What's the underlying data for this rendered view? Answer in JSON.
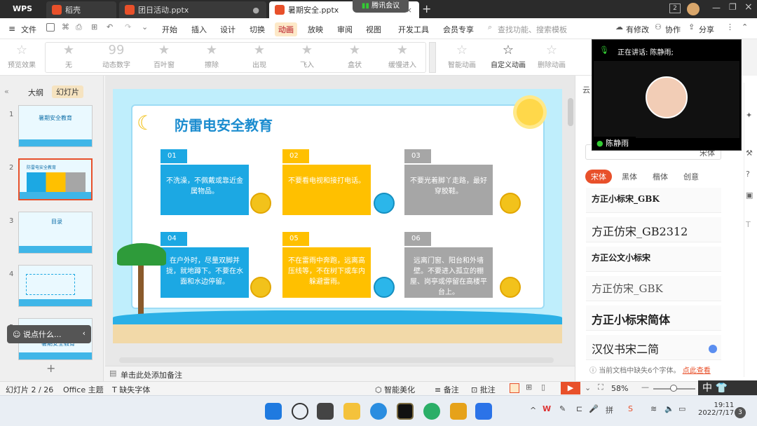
{
  "titlebar": {
    "wps": "WPS",
    "tabs": [
      {
        "label": "稻壳"
      },
      {
        "label": "团日活动.pptx"
      },
      {
        "label": "暑期安全.pptx"
      }
    ],
    "meeting_badge": "腾讯会议",
    "page_indicator": "2"
  },
  "ribbon": {
    "file": "文件",
    "tabs": [
      "开始",
      "插入",
      "设计",
      "切换",
      "动画",
      "放映",
      "审阅",
      "视图",
      "开发工具",
      "会员专享"
    ],
    "active_tab": "动画",
    "search_placeholder": "查找功能、搜索模板",
    "has_changes": "有修改",
    "collab": "协作",
    "share": "分享"
  },
  "toolbar": {
    "preview": "预览效果",
    "effects": [
      "无",
      "动态数字",
      "百叶窗",
      "擦除",
      "出现",
      "飞入",
      "盒状",
      "缓慢进入"
    ],
    "smart_anim": "智能动画",
    "custom_anim": "自定义动画",
    "delete_anim": "删除动画"
  },
  "leftpane": {
    "tab_outline": "大纲",
    "tab_slides": "幻灯片",
    "slides": [
      {
        "num": "1",
        "title": "暑期安全教育"
      },
      {
        "num": "2",
        "title": "防雷电安全教育"
      },
      {
        "num": "3",
        "title": "目录"
      },
      {
        "num": "4",
        "title": ""
      },
      {
        "num": "5",
        "title": "暑期安全教育"
      }
    ],
    "say_something": "说点什么..."
  },
  "slide": {
    "title": "防雷电安全教育",
    "cards": [
      {
        "num": "01",
        "text": "不洗澡，不佩戴或靠近金属物品。"
      },
      {
        "num": "02",
        "text": "不要看电视和接打电话。"
      },
      {
        "num": "03",
        "text": "不要光着脚丫走路，最好穿胶鞋。"
      },
      {
        "num": "04",
        "text": "在户外时，尽量双脚并拢，就地蹲下。不要在水面和水边停留。"
      },
      {
        "num": "05",
        "text": "不在雷雨中奔跑，远离高压线等，不在树下或车内躲避雷雨。"
      },
      {
        "num": "06",
        "text": "远离门窗、阳台和外墙壁。不要进入孤立的棚屋、岗亭或停留在高楼平台上。"
      }
    ],
    "colors": {
      "blue": "#1ca8e3",
      "yellow": "#ffc000",
      "gray": "#a6a6a6"
    }
  },
  "notes": "单击此处添加备注",
  "rightpane": {
    "header": "云",
    "search_btn": "宋体",
    "filters": [
      "宋体",
      "黑体",
      "楷体",
      "创意"
    ],
    "fonts": [
      "方正小标宋_GBK",
      "方正仿宋_GB2312",
      "方正公文小标宋",
      "方正仿宋_GBK",
      "方正小标宋简体",
      "汉仪书宋二简"
    ],
    "missing_notice": "当前文档中缺失6个字体。",
    "view_link": "点此查看"
  },
  "meeting": {
    "speaking": "正在讲话: 陈静雨;",
    "name": "陈静雨"
  },
  "statusbar": {
    "slide_count": "幻灯片 2 / 26",
    "theme": "Office 主题",
    "missing_font": "缺失字体",
    "beautify": "智能美化",
    "notes": "备注",
    "comment": "批注",
    "zoom": "58%",
    "ime": "中"
  },
  "taskbar": {
    "time": "19:11",
    "date": "2022/7/17",
    "notifications": "3"
  }
}
